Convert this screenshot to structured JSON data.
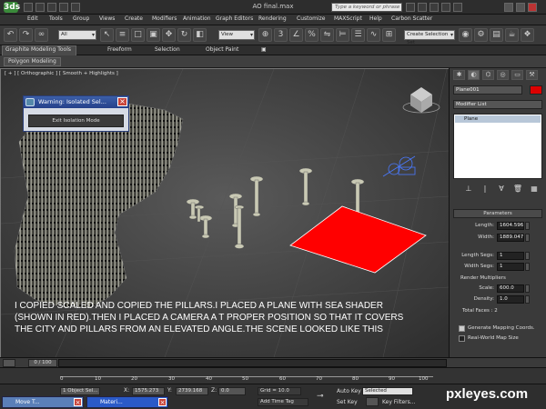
{
  "window": {
    "title": "AO final.max",
    "logo": "3ds",
    "search_placeholder": "Type a keyword or phrase"
  },
  "menu": [
    "Edit",
    "Tools",
    "Group",
    "Views",
    "Create",
    "Modifiers",
    "Animation",
    "Graph Editors",
    "Rendering",
    "Customize",
    "MAXScript",
    "Help",
    "Carbon Scatter"
  ],
  "toolbar": {
    "selection_filter": "All",
    "coord_system": "View",
    "named_selection": "Create Selection Set"
  },
  "ribbon": {
    "tabs": [
      "Graphite Modeling Tools",
      "Freeform",
      "Selection",
      "Object Paint"
    ],
    "panel": "Polygon Modeling"
  },
  "viewport": {
    "label": "[ + ] [ Orthographic ] [ Smooth + Highlights ]",
    "plane_color": "#ff0000"
  },
  "warning": {
    "title": "Warning: Isolated Sel...",
    "button": "Exit Isolation Mode"
  },
  "caption": "I COPIED SCALED AND COPIED THE PILLARS.I PLACED A PLANE WITH SEA SHADER (SHOWN IN RED).THEN I PLACED A CAMERA A T PROPER POSITION SO THAT IT COVERS THE CITY AND PILLARS FROM AN ELEVATED ANGLE.THE SCENE LOOKED LIKE THIS",
  "command_panel": {
    "object_name": "Plane001",
    "object_color": "#dd0000",
    "modifier_list": "Modifier List",
    "stack": [
      "Plane"
    ],
    "rollout": "Parameters",
    "length_label": "Length:",
    "length": "1604.596",
    "width_label": "Width:",
    "width": "1889.047",
    "length_segs_label": "Length Segs:",
    "length_segs": "1",
    "width_segs_label": "Width Segs:",
    "width_segs": "1",
    "render_mult_label": "Render Multipliers",
    "scale_label": "Scale:",
    "scale": "600.0",
    "density_label": "Density:",
    "density": "1.0",
    "total_faces": "Total Faces : 2",
    "gen_mapping": "Generate Mapping Coords.",
    "real_world": "Real-World Map Size"
  },
  "timeline": {
    "slider": "0 / 100",
    "ticks": [
      "0",
      "10",
      "20",
      "30",
      "40",
      "50",
      "60",
      "70",
      "80",
      "90",
      "100"
    ]
  },
  "status": {
    "tasks": [
      "Move T...",
      "Materi..."
    ],
    "selected": "1 Object Sel...",
    "x_label": "X:",
    "x": "1575.273",
    "y_label": "Y:",
    "y": "2739.168",
    "z_label": "Z:",
    "z": "0.0",
    "grid": "Grid = 10.0",
    "add_time_tag": "Add Time Tag",
    "auto_key": "Auto Key",
    "auto_key_value": "Selected",
    "set_key": "Set Key",
    "key_filters": "Key Filters..."
  },
  "watermark": "pxleyes.com"
}
